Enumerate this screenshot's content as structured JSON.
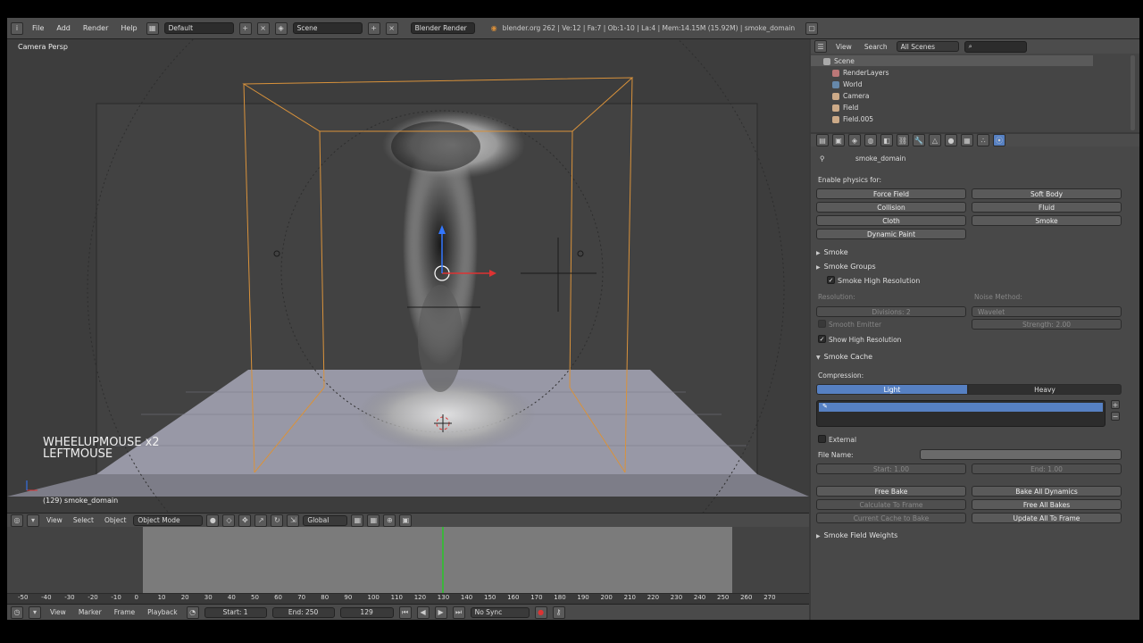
{
  "topbar": {
    "menus": [
      "File",
      "Add",
      "Render",
      "Help"
    ],
    "screen": "Default",
    "scene": "Scene",
    "engine": "Blender Render",
    "stats": "blender.org 262 | Ve:12 | Fa:7 | Ob:1-10 | La:4 | Mem:14.15M (15.92M) | smoke_domain"
  },
  "viewport": {
    "title": "Camera Persp",
    "status": "(129) smoke_domain",
    "keys": [
      "WHEELUPMOUSE x2",
      "LEFTMOUSE"
    ]
  },
  "vp_header": {
    "menus": [
      "View",
      "Select",
      "Object"
    ],
    "mode": "Object Mode",
    "orientation": "Global"
  },
  "timeline": {
    "ruler": [
      "-50",
      "-40",
      "-30",
      "-20",
      "-10",
      "0",
      "10",
      "20",
      "30",
      "40",
      "50",
      "60",
      "70",
      "80",
      "90",
      "100",
      "110",
      "120",
      "130",
      "140",
      "150",
      "160",
      "170",
      "180",
      "190",
      "200",
      "210",
      "220",
      "230",
      "240",
      "250",
      "260",
      "270"
    ],
    "current_frame_value": 130,
    "footer_menus": [
      "View",
      "Marker",
      "Frame",
      "Playback"
    ],
    "start": "Start: 1",
    "end": "End: 250",
    "frame": "129",
    "sync": "No Sync"
  },
  "outliner": {
    "menus": [
      "View",
      "Search"
    ],
    "filter": "All Scenes",
    "rows": [
      "Scene",
      "RenderLayers",
      "World",
      "Camera",
      "Field",
      "Field.005"
    ]
  },
  "props": {
    "object_name": "smoke_domain",
    "enable_label": "Enable physics for:",
    "physics_buttons": [
      "Force Field",
      "Soft Body",
      "Collision",
      "Fluid",
      "Cloth",
      "Smoke",
      "Dynamic Paint"
    ],
    "sections": {
      "smoke": "Smoke",
      "groups": "Smoke Groups",
      "highres": "Smoke High Resolution",
      "cache": "Smoke Cache",
      "field_weights": "Smoke Field Weights"
    },
    "highres": {
      "resolution_label": "Resolution:",
      "noise_label": "Noise Method:",
      "divisions": "Divisions: 2",
      "noise_method": "Wavelet",
      "smooth_emitter": "Smooth Emitter",
      "strength": "Strength: 2.00",
      "show_high": "Show High Resolution"
    },
    "cache": {
      "compression_label": "Compression:",
      "light": "Light",
      "heavy": "Heavy",
      "external": "External",
      "file_name": "File Name:",
      "start": "Start: 1.00",
      "end": "End: 1.00"
    },
    "bake": {
      "free_bake": "Free Bake",
      "bake_all": "Bake All Dynamics",
      "calc_frame": "Calculate To Frame",
      "free_all": "Free All Bakes",
      "current_cache": "Current Cache to Bake",
      "update_all": "Update All To Frame"
    }
  },
  "colors": {
    "accent": "#5680c2",
    "domain_wire": "#d9923b",
    "timeline_range": "#7b7b7b",
    "current_frame": "#3cb43c"
  }
}
